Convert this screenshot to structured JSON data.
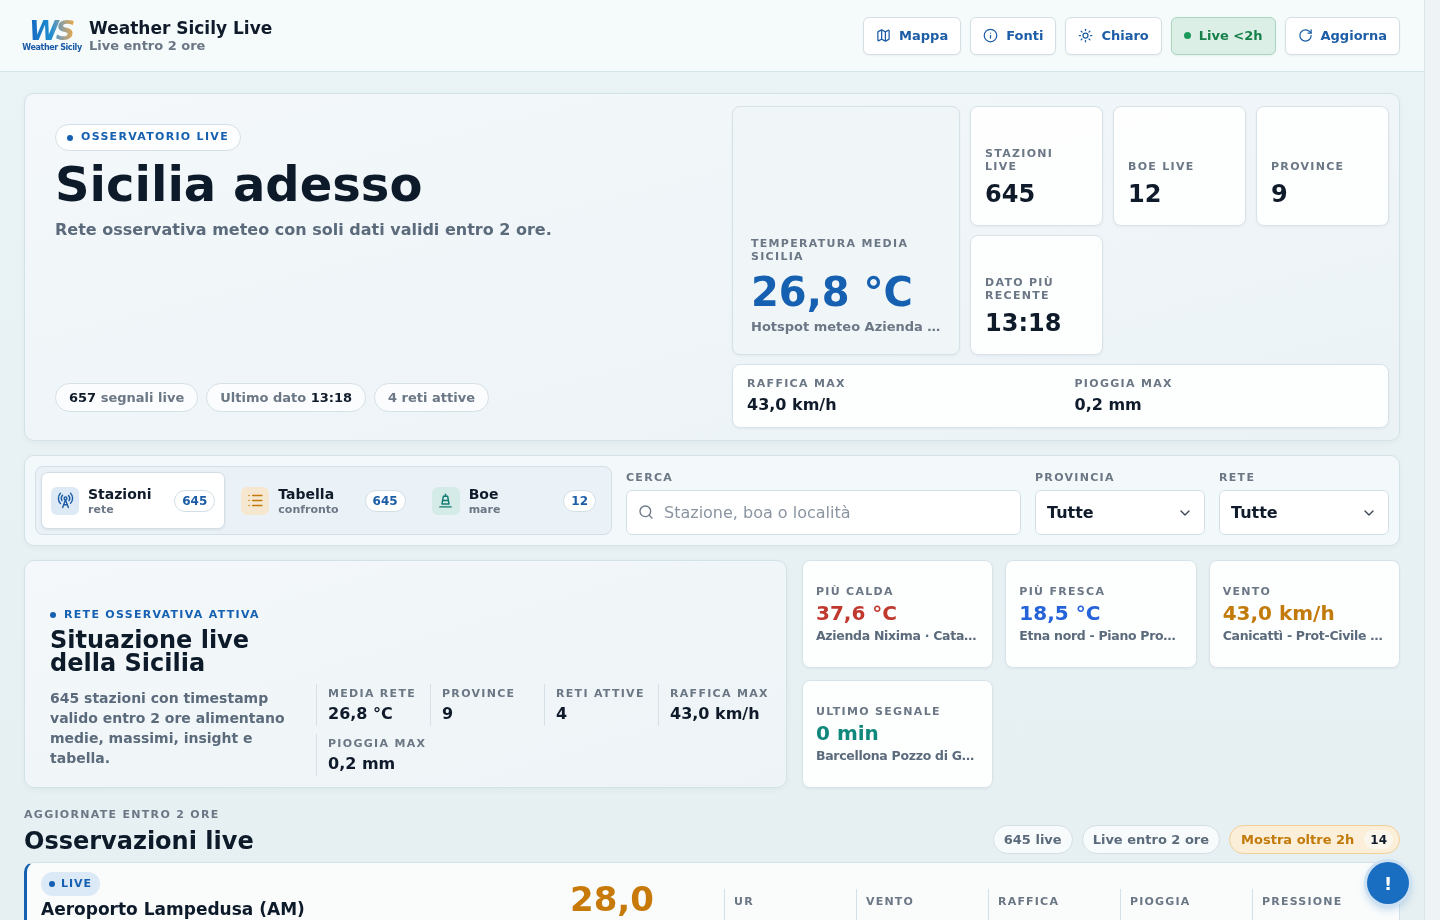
{
  "header": {
    "logo": {
      "mark": "WS",
      "caption": "Weather Sicily"
    },
    "title": "Weather Sicily Live",
    "subtitle": "Live entro 2 ore",
    "actions": [
      {
        "label": "Mappa",
        "kind": "map",
        "on": false
      },
      {
        "label": "Fonti",
        "kind": "info",
        "on": false
      },
      {
        "label": "Chiaro",
        "kind": "theme",
        "on": false
      },
      {
        "label": "Live <2h",
        "kind": "live",
        "on": true
      },
      {
        "label": "Aggiorna",
        "kind": "refresh",
        "on": false
      }
    ]
  },
  "hero": {
    "badge": "OSSERVATORIO LIVE",
    "title": "Sicilia adesso",
    "subtitle": "Rete osservativa meteo con soli dati validi entro 2 ore.",
    "chips": [
      "**657** segnali live",
      "Ultimo dato **13:18**",
      "4 reti attive"
    ],
    "feature": {
      "label": "TEMPERATURA MEDIA SICILIA",
      "value": "26,8 °C",
      "note": "Hotspot meteo Azienda …"
    },
    "stats": [
      {
        "label": "STAZIONI LIVE",
        "value": "645"
      },
      {
        "label": "BOE LIVE",
        "value": "12"
      },
      {
        "label": "PROVINCE",
        "value": "9"
      },
      {
        "label": "DATO PIÙ RECENTE",
        "value": "13:18"
      }
    ],
    "extremes": [
      {
        "label": "RAFFICA MAX",
        "value": "43,0 km/h"
      },
      {
        "label": "PIOGGIA MAX",
        "value": "0,2 mm"
      }
    ]
  },
  "filters": {
    "views": [
      {
        "title": "Stazioni",
        "subtitle": "rete",
        "count": "645",
        "kind": "stations",
        "selected": true
      },
      {
        "title": "Tabella",
        "subtitle": "confronto",
        "count": "645",
        "kind": "table",
        "selected": false
      },
      {
        "title": "Boe",
        "subtitle": "mare",
        "count": "12",
        "kind": "buoys",
        "selected": false
      }
    ],
    "search": {
      "label": "CERCA",
      "placeholder": "Stazione, boa o località"
    },
    "selects": [
      {
        "label": "PROVINCIA",
        "value": "Tutte"
      },
      {
        "label": "RETE",
        "value": "Tutte"
      }
    ]
  },
  "situation": {
    "badge": "RETE OSSERVATIVA ATTIVA",
    "title": "Situazione live della Sicilia",
    "description": "645 stazioni con timestamp valido entro 2 ore alimentano medie, massimi, insight e tabella.",
    "metrics": [
      {
        "label": "MEDIA RETE",
        "value": "26,8 °C"
      },
      {
        "label": "PROVINCE",
        "value": "9"
      },
      {
        "label": "RETI ATTIVE",
        "value": "4"
      },
      {
        "label": "RAFFICA MAX",
        "value": "43,0 km/h"
      },
      {
        "label": "PIOGGIA MAX",
        "value": "0,2 mm"
      }
    ],
    "highlights": [
      {
        "label": "PIÙ CALDA",
        "value": "37,6 °C",
        "place": "Azienda Nixima · Cata…",
        "color": "#c0392f"
      },
      {
        "label": "PIÙ FRESCA",
        "value": "18,5 °C",
        "place": "Etna nord - Piano Pro…",
        "color": "#2563d9"
      },
      {
        "label": "VENTO",
        "value": "43,0 km/h",
        "place": "Canicattì - Prot-Civile …",
        "color": "#c27a0a"
      },
      {
        "label": "ULTIMO SEGNALE",
        "value": "0 min",
        "place": "Barcellona Pozzo di G…",
        "color": "#0f877a"
      }
    ]
  },
  "observations": {
    "eyebrow": "AGGIORNATE ENTRO 2 ORE",
    "title": "Osservazioni live",
    "chips": [
      {
        "label": "645 live",
        "kind": "plain"
      },
      {
        "label": "Live entro 2 ore",
        "kind": "plain"
      },
      {
        "label": "Mostra oltre 2h",
        "count": "14",
        "kind": "warning"
      }
    ],
    "rows": [
      {
        "badge": "LIVE",
        "name": "Aeroporto Lampedusa (AM)",
        "temperature": "28,0",
        "columns": [
          "UR",
          "VENTO",
          "RAFFICA",
          "PIOGGIA",
          "PRESSIONE"
        ]
      }
    ]
  },
  "fab": {
    "label": "!"
  }
}
